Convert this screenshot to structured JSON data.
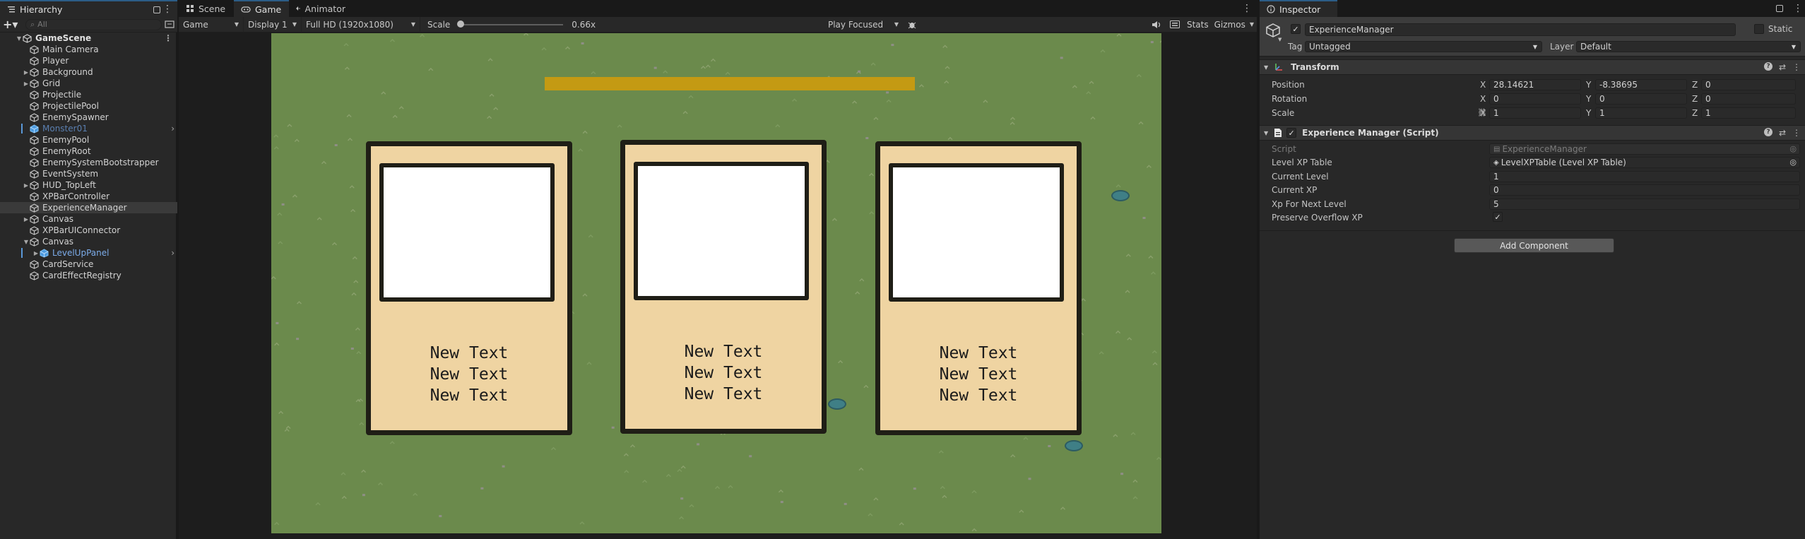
{
  "hierarchy": {
    "tab_label": "Hierarchy",
    "search_placeholder": "All",
    "scene_name": "GameScene",
    "items": [
      {
        "label": "Main Camera",
        "depth": 1,
        "expandable": false,
        "style": "normal"
      },
      {
        "label": "Player",
        "depth": 1,
        "expandable": false,
        "style": "normal"
      },
      {
        "label": "Background",
        "depth": 1,
        "expandable": true,
        "style": "normal"
      },
      {
        "label": "Grid",
        "depth": 1,
        "expandable": true,
        "style": "normal"
      },
      {
        "label": "Projectile",
        "depth": 1,
        "expandable": false,
        "style": "normal"
      },
      {
        "label": "ProjectilePool",
        "depth": 1,
        "expandable": false,
        "style": "normal"
      },
      {
        "label": "EnemySpawner",
        "depth": 1,
        "expandable": false,
        "style": "normal"
      },
      {
        "label": "Monster01",
        "depth": 1,
        "expandable": false,
        "style": "faded"
      },
      {
        "label": "EnemyPool",
        "depth": 1,
        "expandable": false,
        "style": "normal"
      },
      {
        "label": "EnemyRoot",
        "depth": 1,
        "expandable": false,
        "style": "normal"
      },
      {
        "label": "EnemySystemBootstrapper",
        "depth": 1,
        "expandable": false,
        "style": "normal"
      },
      {
        "label": "EventSystem",
        "depth": 1,
        "expandable": false,
        "style": "normal"
      },
      {
        "label": "HUD_TopLeft",
        "depth": 1,
        "expandable": true,
        "style": "normal"
      },
      {
        "label": "XPBarController",
        "depth": 1,
        "expandable": false,
        "style": "normal"
      },
      {
        "label": "ExperienceManager",
        "depth": 1,
        "expandable": false,
        "style": "selected"
      },
      {
        "label": "Canvas",
        "depth": 1,
        "expandable": true,
        "style": "normal"
      },
      {
        "label": "XPBarUIConnector",
        "depth": 1,
        "expandable": false,
        "style": "normal"
      },
      {
        "label": "Canvas",
        "depth": 1,
        "expandable": true,
        "expanded": true,
        "style": "normal"
      },
      {
        "label": "LevelUpPanel",
        "depth": 2,
        "expandable": true,
        "style": "prefab"
      },
      {
        "label": "CardService",
        "depth": 1,
        "expandable": false,
        "style": "normal"
      },
      {
        "label": "CardEffectRegistry",
        "depth": 1,
        "expandable": false,
        "style": "normal"
      }
    ]
  },
  "game": {
    "tabs": [
      {
        "label": "Scene",
        "active": false
      },
      {
        "label": "Game",
        "active": true
      },
      {
        "label": "Animator",
        "active": false
      }
    ],
    "toolbar": {
      "mode": "Game",
      "display": "Display 1",
      "resolution": "Full HD (1920x1080)",
      "scale_label": "Scale",
      "scale_value": "0.66x",
      "play_focus": "Play Focused",
      "stats": "Stats",
      "gizmos": "Gizmos"
    },
    "cards": [
      {
        "lines": [
          "New Text",
          "New Text",
          "New Text"
        ]
      },
      {
        "lines": [
          "New Text",
          "New Text",
          "New Text"
        ]
      },
      {
        "lines": [
          "New Text",
          "New Text",
          "New Text"
        ]
      }
    ],
    "colors": {
      "grass": "#6b8a4c",
      "xp_bar": "#c49a13",
      "card": "#efd4a2",
      "card_border": "#1f1e16"
    }
  },
  "inspector": {
    "tab_label": "Inspector",
    "object_name": "ExperienceManager",
    "static_label": "Static",
    "tag_label": "Tag",
    "tag_value": "Untagged",
    "layer_label": "Layer",
    "layer_value": "Default",
    "transform": {
      "title": "Transform",
      "rows": [
        {
          "label": "Position",
          "x": "28.14621",
          "y": "-8.38695",
          "z": "0"
        },
        {
          "label": "Rotation",
          "x": "0",
          "y": "0",
          "z": "0"
        },
        {
          "label": "Scale",
          "x": "1",
          "y": "1",
          "z": "1"
        }
      ]
    },
    "script_component": {
      "title": "Experience Manager (Script)",
      "fields": [
        {
          "label": "Script",
          "value": "ExperienceManager",
          "kind": "object-disabled"
        },
        {
          "label": "Level XP Table",
          "value": "LevelXPTable (Level XP Table)",
          "kind": "object"
        },
        {
          "label": "Current Level",
          "value": "1",
          "kind": "text"
        },
        {
          "label": "Current XP",
          "value": "0",
          "kind": "text"
        },
        {
          "label": "Xp For Next Level",
          "value": "5",
          "kind": "text"
        },
        {
          "label": "Preserve Overflow XP",
          "value": "✓",
          "kind": "check"
        }
      ]
    },
    "add_component": "Add Component"
  }
}
